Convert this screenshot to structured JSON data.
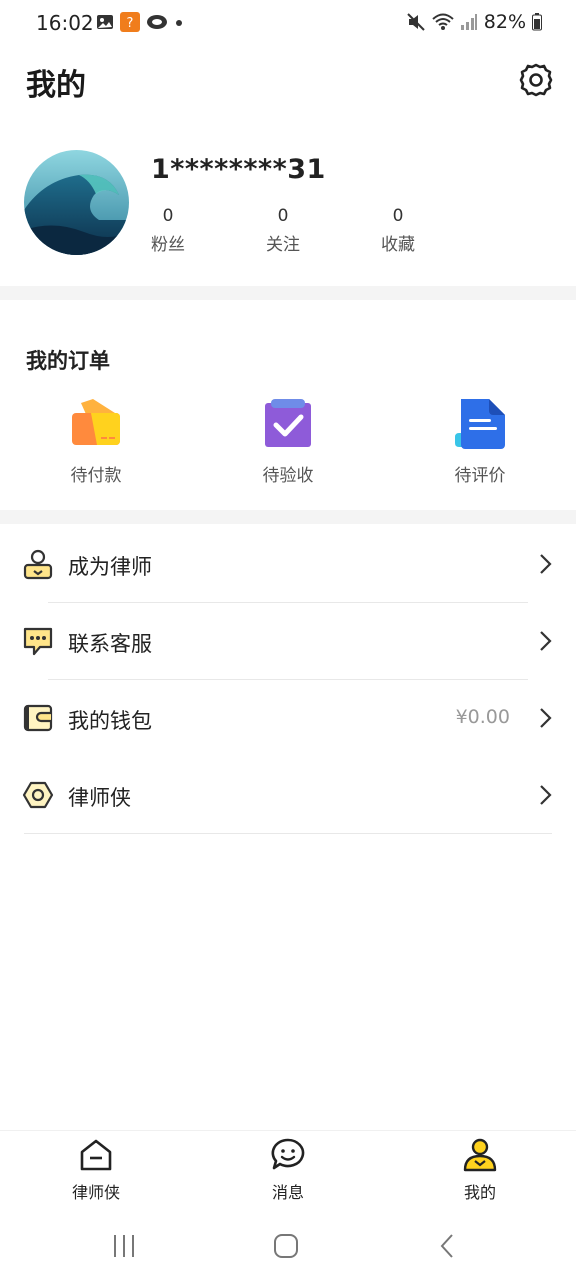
{
  "status_bar": {
    "time": "16:02",
    "battery": "82%"
  },
  "header": {
    "title": "我的"
  },
  "profile": {
    "username": "1********31",
    "stats": [
      {
        "value": "0",
        "label": "粉丝"
      },
      {
        "value": "0",
        "label": "关注"
      },
      {
        "value": "0",
        "label": "收藏"
      }
    ]
  },
  "orders": {
    "title": "我的订单",
    "items": [
      {
        "label": "待付款",
        "icon": "card-icon"
      },
      {
        "label": "待验收",
        "icon": "clipboard-check-icon"
      },
      {
        "label": "待评价",
        "icon": "document-icon"
      }
    ]
  },
  "menu": {
    "items": [
      {
        "label": "成为律师",
        "icon": "person-badge-icon",
        "value": ""
      },
      {
        "label": "联系客服",
        "icon": "chat-dots-icon",
        "value": ""
      },
      {
        "label": "我的钱包",
        "icon": "wallet-icon",
        "value": "¥0.00"
      },
      {
        "label": "律师侠",
        "icon": "hexagon-icon",
        "value": ""
      }
    ]
  },
  "bottom_nav": {
    "items": [
      {
        "label": "律师侠",
        "icon": "home-icon",
        "active": false
      },
      {
        "label": "消息",
        "icon": "message-smile-icon",
        "active": false
      },
      {
        "label": "我的",
        "icon": "profile-icon",
        "active": true
      }
    ]
  },
  "colors": {
    "accent_yellow": "#FFD21E",
    "order_orange": "#FF8A3D",
    "order_purple": "#8E5BD9",
    "order_blue": "#2E6FE8"
  }
}
